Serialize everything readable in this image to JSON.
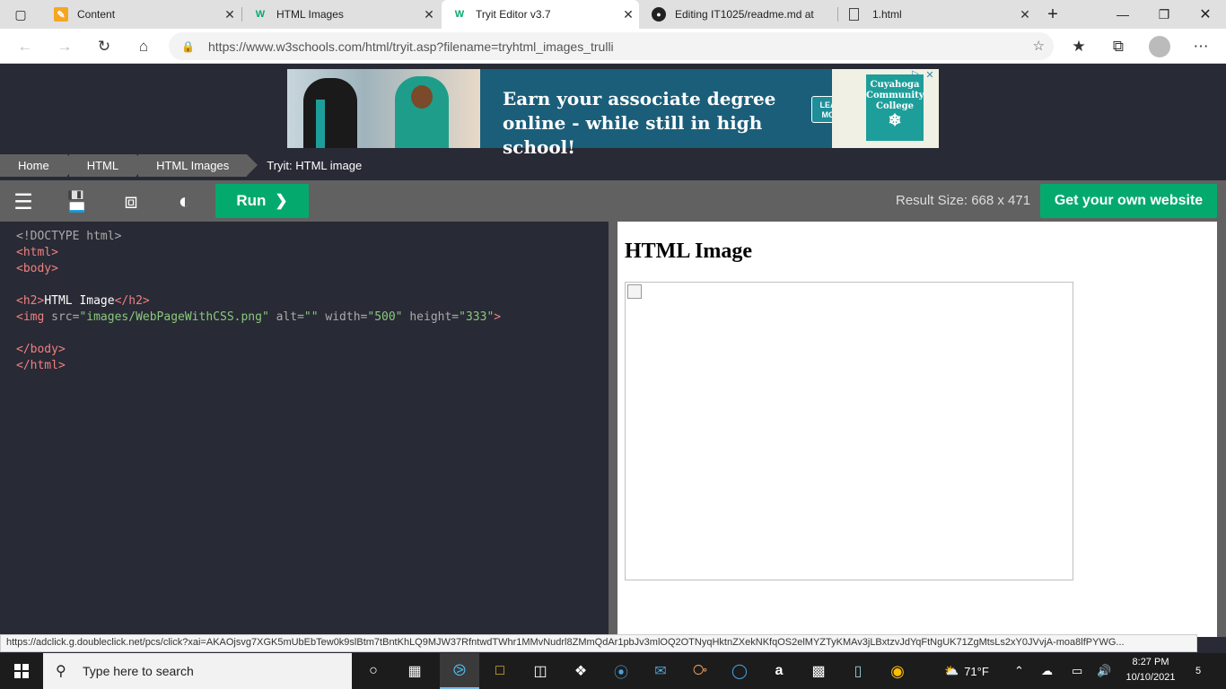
{
  "browser": {
    "tabs": [
      {
        "label": "Content",
        "icon": "pencil-doc-icon",
        "color": "#f5a623"
      },
      {
        "label": "HTML Images",
        "icon": "w3schools-icon",
        "color": "#04aa6d"
      },
      {
        "label": "Tryit Editor v3.7",
        "icon": "w3schools-icon",
        "color": "#04aa6d",
        "active": true
      },
      {
        "label": "Editing IT1025/readme.md at",
        "icon": "github-icon",
        "color": "#222222"
      },
      {
        "label": "1.html",
        "icon": "file-icon",
        "color": "#444444"
      }
    ],
    "url": "https://www.w3schools.com/html/tryit.asp?filename=tryhtml_images_trulli"
  },
  "ad": {
    "headline": "Earn your associate degree online - while still in high school!",
    "learn_more": "LEARN MORE",
    "college": "Cuyahoga Community College"
  },
  "breadcrumb": [
    "Home",
    "HTML",
    "HTML Images",
    "Tryit: HTML image"
  ],
  "toolbar": {
    "run_label": "Run",
    "result_size": "Result Size: 668 x 471",
    "get_website": "Get your own website"
  },
  "code_lines": [
    [
      {
        "t": "<!DOCTYPE html>",
        "c": "doc"
      }
    ],
    [
      {
        "t": "<html>",
        "c": "tag"
      }
    ],
    [
      {
        "t": "<body>",
        "c": "tag"
      }
    ],
    [],
    [
      {
        "t": "<h2>",
        "c": "tag"
      },
      {
        "t": "HTML Image",
        "c": "txt"
      },
      {
        "t": "</h2>",
        "c": "tag"
      }
    ],
    [
      {
        "t": "<img ",
        "c": "tag"
      },
      {
        "t": "src=",
        "c": "attr"
      },
      {
        "t": "\"images/WebPageWithCSS.png\"",
        "c": "val"
      },
      {
        "t": " alt=",
        "c": "attr"
      },
      {
        "t": "\"\"",
        "c": "val"
      },
      {
        "t": " width=",
        "c": "attr"
      },
      {
        "t": "\"500\"",
        "c": "val"
      },
      {
        "t": " height=",
        "c": "attr"
      },
      {
        "t": "\"333\"",
        "c": "val"
      },
      {
        "t": ">",
        "c": "tag"
      }
    ],
    [],
    [
      {
        "t": "</body>",
        "c": "tag"
      }
    ],
    [
      {
        "t": "</html>",
        "c": "tag"
      }
    ]
  ],
  "result": {
    "heading": "HTML Image"
  },
  "status_url": "https://adclick.g.doubleclick.net/pcs/click?xai=AKAOjsvg7XGK5mUbEbTew0k9slBtm7tBntKhLQ9MJW37RfntwdTWhr1MMvNudrl8ZMmQdAr1pbJv3mlOQ2OTNyqHktnZXekNKfqOS2elMYZTyKMAv3jLBxtzvJdYqFtNgUK71ZgMtsLs2xY0JVvjA-moa8lfPYWG...",
  "taskbar": {
    "search_placeholder": "Type here to search",
    "weather": "71°F",
    "time": "8:27 PM",
    "date": "10/10/2021",
    "notifications": "5"
  },
  "colors": {
    "w3_green": "#04aa6d",
    "editor_bg": "#282a35",
    "toolbar_gray": "#616161"
  }
}
